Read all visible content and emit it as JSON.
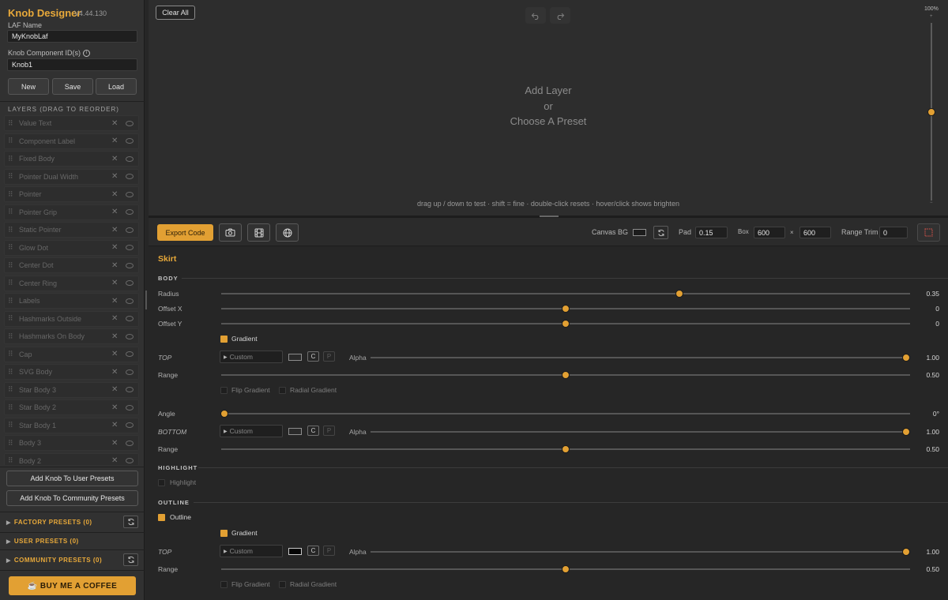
{
  "sidebar": {
    "app_title": "Knob Designer",
    "version": "V4.44.130",
    "laf_label": "LAF Name",
    "laf_value": "MyKnobLaf",
    "component_label": "Knob Component ID(s)",
    "component_value": "Knob1",
    "new_label": "New",
    "save_label": "Save",
    "load_label": "Load",
    "layers_header": "LAYERS (DRAG TO REORDER)",
    "layers": [
      "Value Text",
      "Component Label",
      "Fixed Body",
      "Pointer Dual Width",
      "Pointer",
      "Pointer Grip",
      "Static Pointer",
      "Glow Dot",
      "Center Dot",
      "Center Ring",
      "Labels",
      "Hashmarks Outside",
      "Hashmarks On Body",
      "Cap",
      "SVG Body",
      "Star Body 3",
      "Star Body 2",
      "Star Body 1",
      "Body 3",
      "Body 2"
    ],
    "add_user_preset_label": "Add Knob To User Presets",
    "add_community_preset_label": "Add Knob To Community Presets",
    "factory_presets_label": "FACTORY PRESETS (0)",
    "user_presets_label": "USER PRESETS (0)",
    "community_presets_label": "COMMUNITY PRESETS (0)",
    "coffee_label": "☕ BUY ME A COFFEE"
  },
  "canvas": {
    "clear_all_label": "Clear All",
    "placeholder_line1": "Add Layer",
    "placeholder_line2": "or",
    "placeholder_line3": "Choose A Preset",
    "hint": "drag up / down to test · shift = fine · double-click resets · hover/click shows brighten",
    "zoom_label": "100%",
    "zoom_level": 0.5
  },
  "toolbar": {
    "export_label": "Export Code",
    "canvas_bg_label": "Canvas BG",
    "pad_label": "Pad",
    "pad_value": "0.15",
    "box_label": "Box",
    "box_width": "600",
    "box_x": "×",
    "box_height": "600",
    "range_trim_label": "Range Trim",
    "range_trim_value": "0"
  },
  "editor": {
    "section_title": "Skirt",
    "body_header": "BODY",
    "radius_label": "Radius",
    "radius_value": "0.35",
    "radius_level": 0.665,
    "offset_x_label": "Offset X",
    "offset_x_value": "0",
    "offset_x_level": 0.5,
    "offset_y_label": "Offset Y",
    "offset_y_value": "0",
    "offset_y_level": 0.5,
    "gradient_label": "Gradient",
    "top_label": "TOP",
    "custom_label": "Custom",
    "c_label": "C",
    "p_label": "P",
    "alpha_label": "Alpha",
    "top_alpha_value": "1.00",
    "range_label": "Range",
    "range_value": "0.50",
    "flip_gradient_label": "Flip Gradient",
    "radial_gradient_label": "Radial Gradient",
    "angle_label": "Angle",
    "angle_value": "0°",
    "bottom_label": "BOTTOM",
    "bottom_alpha_value": "1.00",
    "bottom_range_value": "0.50",
    "highlight_header": "HIGHLIGHT",
    "highlight_label": "Highlight",
    "outline_header": "OUTLINE",
    "outline_label": "Outline",
    "outline_gradient_label": "Gradient",
    "outline_top_label": "TOP",
    "outline_alpha_value": "1.00",
    "outline_range_value": "0.50"
  },
  "colors": {
    "accent": "#e2a033",
    "panel_bg": "#313131",
    "canvas_bg": "#2d2d2d"
  },
  "icons": [
    "undo-icon",
    "redo-icon",
    "camera-icon",
    "film-icon",
    "globe-icon",
    "refresh-icon",
    "info-icon",
    "drag-handle-icon",
    "close-icon",
    "select-box-icon"
  ]
}
